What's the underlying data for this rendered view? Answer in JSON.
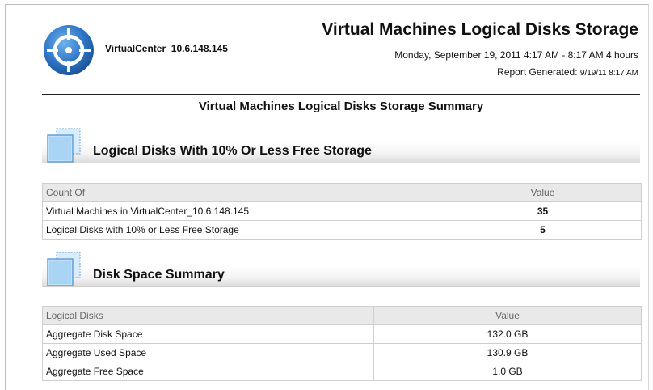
{
  "header": {
    "host_name": "VirtualCenter_10.6.148.145",
    "report_title": "Virtual Machines Logical Disks Storage",
    "report_range": "Monday, September 19, 2011  4:17 AM - 8:17 AM  4 hours",
    "report_generated_label": "Report Generated:",
    "report_generated_value": "9/19/11 8:17 AM",
    "logo_icon": "crosshair-target-icon"
  },
  "summary_title": "Virtual Machines Logical Disks Storage Summary",
  "sections": [
    {
      "title": "Logical Disks With 10% Or Less Free Storage",
      "icon": "disk-stack-icon",
      "columns": [
        "Count Of",
        "Value"
      ],
      "rows": [
        {
          "label": "Virtual Machines in VirtualCenter_10.6.148.145",
          "value": "35"
        },
        {
          "label": "Logical Disks with 10% or Less Free Storage",
          "value": "5"
        }
      ]
    },
    {
      "title": "Disk Space Summary",
      "icon": "disk-stack-icon",
      "columns": [
        "Logical Disks",
        "Value"
      ],
      "rows": [
        {
          "label": "Aggregate Disk Space",
          "value": "132.0 GB"
        },
        {
          "label": "Aggregate Used Space",
          "value": "130.9 GB"
        },
        {
          "label": "Aggregate Free Space",
          "value": "1.0 GB"
        }
      ]
    }
  ],
  "colors": {
    "logo_blue": "#2e74c4",
    "section_band": "#dcdcdc",
    "table_header": "#e9e9e9"
  }
}
